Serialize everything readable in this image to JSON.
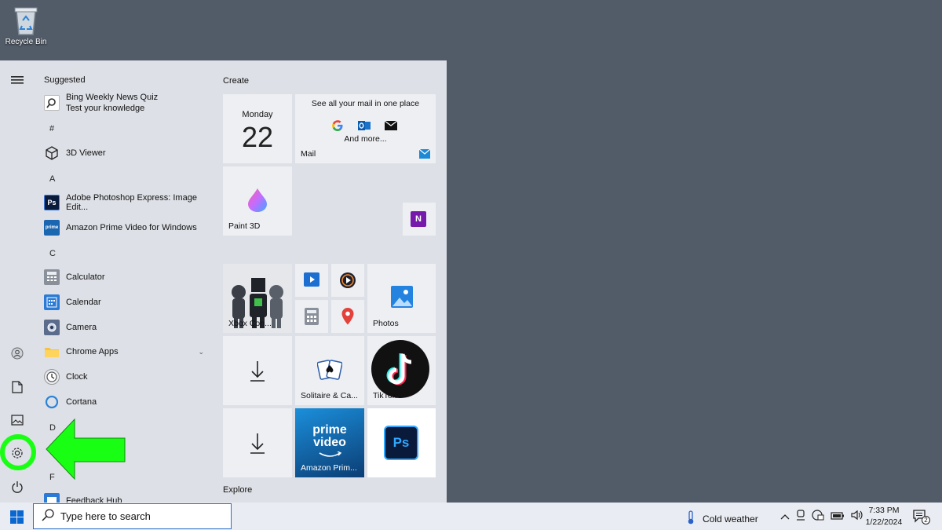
{
  "desktop": {
    "recycle_bin_label": "Recycle Bin"
  },
  "start_menu": {
    "suggested_title": "Suggested",
    "suggested_app": {
      "line1": "Bing Weekly News Quiz",
      "line2": "Test your knowledge"
    },
    "letters": {
      "hash": "#",
      "a": "A",
      "c": "C",
      "d": "D",
      "f": "F"
    },
    "apps": {
      "viewer3d": "3D Viewer",
      "photoshop": "Adobe Photoshop Express: Image Edit...",
      "prime": "Amazon Prime Video for Windows",
      "calculator": "Calculator",
      "calendar": "Calendar",
      "camera": "Camera",
      "chrome_apps": "Chrome Apps",
      "clock": "Clock",
      "cortana": "Cortana",
      "feedback": "Feedback Hub"
    },
    "tiles": {
      "create_title": "Create",
      "explore_title": "Explore",
      "calendar_day": "Monday",
      "calendar_date": "22",
      "mail_headline": "See all your mail in one place",
      "mail_more": "And more...",
      "mail_label": "Mail",
      "paint3d_label": "Paint 3D",
      "xbox_label": "Xbox Con...",
      "photos_label": "Photos",
      "solitaire_label": "Solitaire & Ca...",
      "tiktok_label": "TikTok",
      "prime_line1": "prime",
      "prime_line2": "video",
      "prime_label": "Amazon Prim...",
      "ps_label": "Ps",
      "onenote_label": "N"
    }
  },
  "taskbar": {
    "search_placeholder": "Type here to search",
    "weather_text": "Cold weather",
    "time": "7:33 PM",
    "date": "1/22/2024",
    "notification_count": "2"
  },
  "colors": {
    "annotation": "#19ff14",
    "accent": "#2c70c7"
  }
}
